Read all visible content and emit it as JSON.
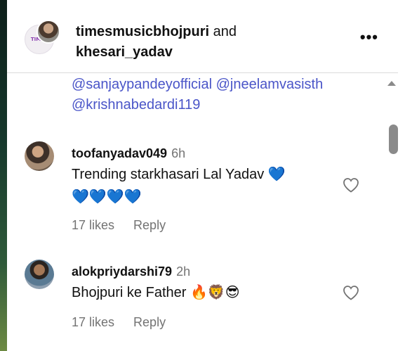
{
  "header": {
    "user1": "timesmusicbhojpuri",
    "conjunction": "and",
    "user2": "khesari_yadav",
    "avatar_logo_text": "TIMES",
    "more_icon": "ellipsis-icon"
  },
  "caption": {
    "mentions": [
      "@sanjaypandeyofficial",
      "@jneelamvasisth",
      "@krishnabedardi119"
    ]
  },
  "comments": [
    {
      "username": "toofanyadav049",
      "time": "6h",
      "text": "Trending starkhasari Lal Yadav",
      "emoji_line1": "💙",
      "emoji_line2": "💙💙💙💙",
      "likes": "17 likes",
      "reply": "Reply"
    },
    {
      "username": "alokpriydarshi79",
      "time": "2h",
      "text": "Bhojpuri ke Father",
      "emojis": "🔥🦁😎",
      "likes": "17 likes",
      "reply": "Reply"
    }
  ],
  "colors": {
    "mention": "#4a55c8",
    "muted": "#737373",
    "heart_blue": "#1f6fe0"
  }
}
